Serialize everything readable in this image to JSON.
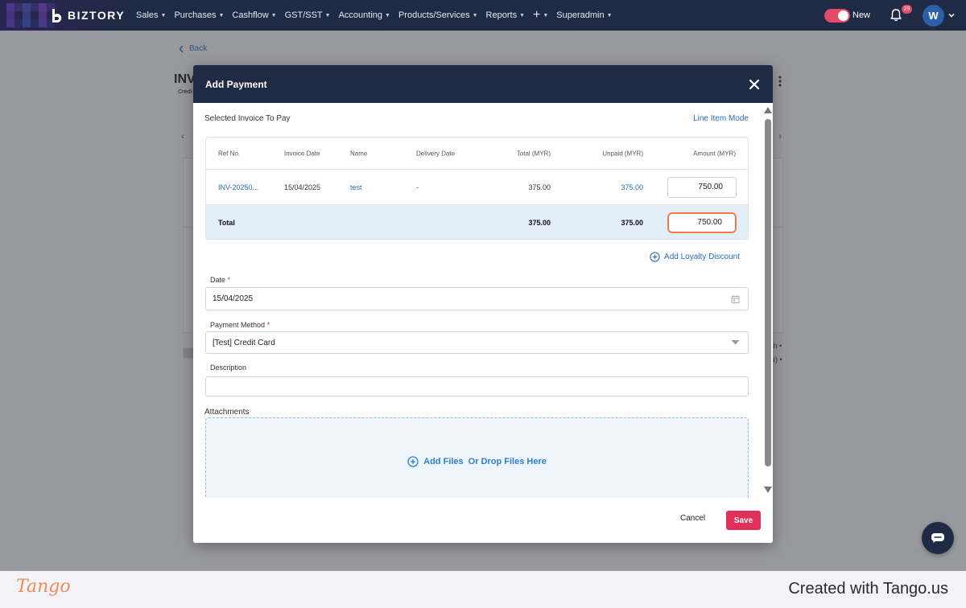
{
  "app": {
    "brand": "BIZTORY",
    "nav": [
      "Sales",
      "Purchases",
      "Cashflow",
      "GST/SST",
      "Accounting",
      "Products/Services",
      "Reports",
      "+",
      "Superadmin"
    ],
    "toggle_label": "New",
    "notification_count": "29",
    "avatar_initial": "W"
  },
  "page": {
    "back_label": "Back",
    "title_fragment": "INV",
    "sub_fragment": "Credi",
    "right_text_1": "sh •",
    "right_text_2": "ai) •"
  },
  "modal": {
    "title": "Add Payment",
    "section_label": "Selected Invoice To Pay",
    "line_item_mode": "Line Item Mode",
    "table": {
      "headers": [
        "Ref No.",
        "Invoice Date",
        "Name",
        "Delivery Date",
        "Total (MYR)",
        "Unpaid (MYR)",
        "Amount (MYR)"
      ],
      "rows": [
        {
          "ref": "INV-20250...",
          "date": "15/04/2025",
          "name": "test",
          "delivery": "-",
          "total": "375.00",
          "unpaid": "375.00",
          "amount": "750.00"
        }
      ],
      "total": {
        "label": "Total",
        "total": "375.00",
        "unpaid": "375.00",
        "amount": "750.00"
      }
    },
    "loyalty_label": "Add Loyalty Discount",
    "date_label": "Date",
    "date_value": "15/04/2025",
    "payment_method_label": "Payment Method",
    "payment_method_value": "[Test] Credit Card",
    "description_label": "Description",
    "description_value": "",
    "attachments_label": "Attachments",
    "dropzone_link": "Add Files",
    "dropzone_text": "Or Drop Files Here",
    "cancel_label": "Cancel",
    "save_label": "Save"
  },
  "footer": {
    "logo": "Tango",
    "credit": "Created with Tango.us"
  },
  "colors": {
    "nav_bg": "#1f2a44",
    "accent_blue": "#2a6bbf",
    "save_red": "#e0305a",
    "highlight_orange": "#f07a44"
  }
}
